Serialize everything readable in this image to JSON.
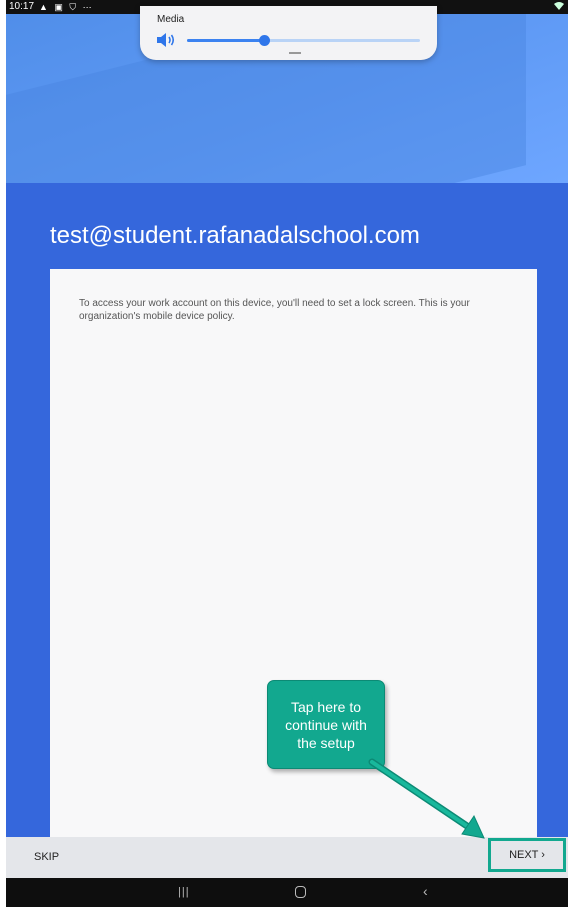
{
  "status_bar": {
    "time": "10:17",
    "icons": [
      "warning-icon",
      "image-icon",
      "shield-icon",
      "more-icon"
    ],
    "icon_glyphs": "▲ ▣ ⛉ ⋯"
  },
  "media_popup": {
    "label": "Media",
    "volume_fraction": 0.33
  },
  "account": {
    "email": "test@student.rafanadalschool.com"
  },
  "card": {
    "message": "To access your work account on this device, you'll need to set a lock screen. This is your organization's mobile device policy."
  },
  "callout": {
    "text": "Tap here to continue with the setup"
  },
  "actions": {
    "skip_label": "SKIP",
    "next_label": "NEXT ›"
  },
  "colors": {
    "header_blue": "#5f9af5",
    "body_blue": "#3567dc",
    "callout_green": "#12a88f"
  }
}
